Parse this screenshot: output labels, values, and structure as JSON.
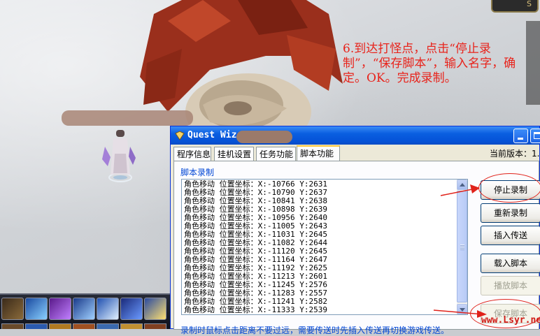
{
  "annotation": "6.到达打怪点，点击“停止录制”，“保存脚本”，输入名字，确定。OK。完成录制。",
  "window": {
    "title": "Quest Wiz",
    "tabs": [
      "程序信息",
      "挂机设置",
      "任务功能",
      "脚本功能"
    ],
    "active_tab": "脚本功能",
    "version_label": "当前版本：1."
  },
  "script_record": {
    "group_label": "脚本录制",
    "log": [
      "角色移动 位置坐标：X:-10766 Y:2631",
      "角色移动 位置坐标：X:-10790 Y:2637",
      "角色移动 位置坐标：X:-10841 Y:2638",
      "角色移动 位置坐标：X:-10898 Y:2639",
      "角色移动 位置坐标：X:-10956 Y:2640",
      "角色移动 位置坐标：X:-11005 Y:2643",
      "角色移动 位置坐标：X:-11031 Y:2645",
      "角色移动 位置坐标：X:-11082 Y:2644",
      "角色移动 位置坐标：X:-11120 Y:2645",
      "角色移动 位置坐标：X:-11164 Y:2647",
      "角色移动 位置坐标：X:-11192 Y:2625",
      "角色移动 位置坐标：X:-11213 Y:2601",
      "角色移动 位置坐标：X:-11245 Y:2576",
      "角色移动 位置坐标：X:-11283 Y:2557",
      "角色移动 位置坐标：X:-11241 Y:2582",
      "角色移动 位置坐标：X:-11333 Y:2539"
    ],
    "buttons": {
      "stop_record": "停止录制",
      "re_record": "重新录制",
      "insert_teleport": "插入传送",
      "load_script": "载入脚本",
      "play_script": "播放脚本",
      "save_script": "保存脚本"
    },
    "status_hint": "录制时鼠标点击距离不要过远，需要传送时先插入传送再切换游戏传送。"
  },
  "watermark": "www.Lsyr.net",
  "corner_badge": "S",
  "colors": {
    "annotation_red": "#e8231b",
    "xp_title_blue": "#0a5ee0",
    "group_label_blue": "#0046d5"
  },
  "icons": [
    "window-app-icon",
    "minimize-icon",
    "maximize-icon",
    "scroll-up-icon",
    "scroll-down-icon",
    "arrow-pointer-icon"
  ]
}
